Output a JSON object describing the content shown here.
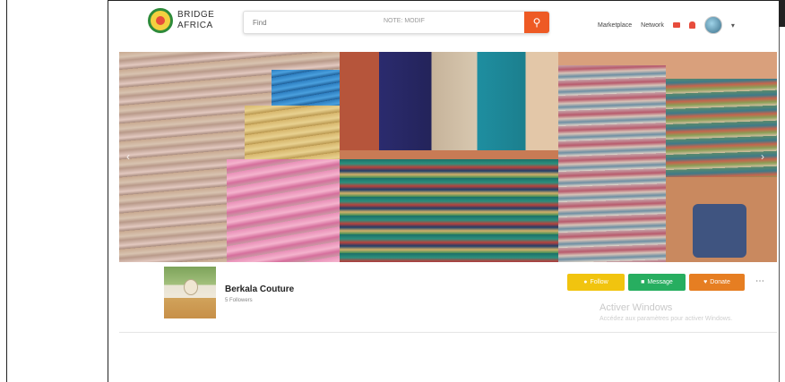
{
  "header": {
    "logo_line1": "BRIDGE",
    "logo_line2": "AFRICA",
    "search_placeholder": "Find",
    "search_mid_text": "NOTE: MODIF",
    "nav": {
      "link1": "Marketplace",
      "link2": "Network"
    },
    "icons": [
      "search-icon",
      "message-icon",
      "bell-icon",
      "avatar",
      "chevron-down-icon"
    ]
  },
  "banner": {
    "prev_label": "‹",
    "next_label": "›"
  },
  "profile": {
    "name": "Berkala Couture",
    "subtitle": "5 Followers",
    "buttons": {
      "follow": "Follow",
      "message": "Message",
      "donate": "Donate"
    },
    "more_label": "⋯",
    "watermark_title": "Activer Windows",
    "watermark_sub": "Accédez aux paramètres pour activer Windows."
  },
  "colors": {
    "accent": "#ee5a24",
    "follow": "#f1c40f",
    "message": "#27ae60",
    "donate": "#e67e22"
  }
}
